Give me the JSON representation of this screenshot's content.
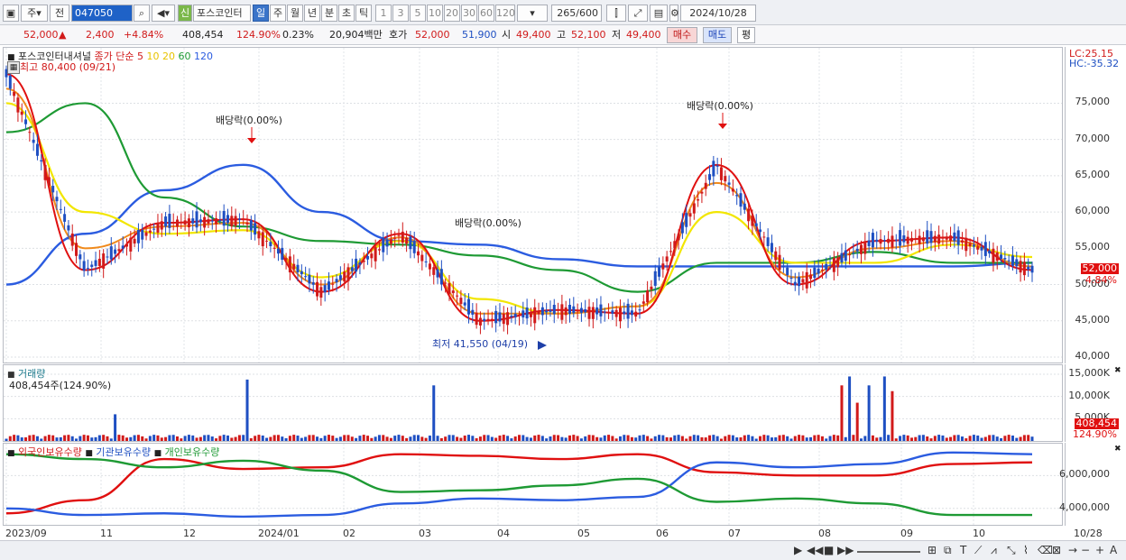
{
  "toolbar": {
    "market": "주",
    "prefix": "전",
    "code": "047050",
    "new_badge": "신",
    "stock_name": "포스코인터",
    "periods": [
      "일",
      "주",
      "월",
      "년",
      "분",
      "초",
      "틱"
    ],
    "active_period": "일",
    "intervals": [
      "1",
      "3",
      "5",
      "10",
      "20",
      "30",
      "60",
      "120"
    ],
    "count": "265",
    "count_total": "/600",
    "date": "2024/10/28"
  },
  "quote": {
    "price": "52,000",
    "change_arrow": "▲",
    "change": "2,400",
    "change_pct": "+4.84%",
    "volume": "408,454",
    "volume_ratio": "124.90%",
    "turnover": "0.23%",
    "amount": "20,904백만",
    "hoga_label": "호가",
    "ask": "52,000",
    "bid": "51,900",
    "open_label": "시",
    "open": "49,400",
    "high_label": "고",
    "high": "52,100",
    "low_label": "저",
    "low": "49,400",
    "buy_btn": "매수",
    "sell_btn": "매도",
    "eval_btn": "평"
  },
  "price_panel": {
    "title": "포스코인터내셔널",
    "ma_label": "종가 단순",
    "ma_periods": [
      "5",
      "10",
      "20",
      "60",
      "120"
    ],
    "high_note": "최고 80,400 (09/21)",
    "low_note": "최저 41,550 (04/19)",
    "dividend1": "배당락(0.00%)",
    "dividend2": "배당락(0.00%)",
    "dividend3": "배당락(0.00%)",
    "lc": "LC:25.15",
    "hc": "HC:-35.32",
    "y_ticks": [
      "75,000",
      "70,000",
      "65,000",
      "60,000",
      "55,000",
      "50,000",
      "45,000",
      "40,000"
    ],
    "last_price_tag": "52,000",
    "last_pct_tag": "4.84%"
  },
  "volume_panel": {
    "title": "거래량",
    "info": "408,454주(124.90%)",
    "y_ticks": [
      "15,000K",
      "10,000K",
      "5,000K"
    ],
    "tag": "408,454",
    "tag_pct": "124.90%"
  },
  "holding_panel": {
    "series": [
      "외국인보유수량",
      "기관보유수량",
      "개인보유수량"
    ],
    "y_ticks": [
      "6,000,000",
      "4,000,000"
    ]
  },
  "x_axis": [
    "2023/09",
    "11",
    "12",
    "2024/01",
    "02",
    "03",
    "04",
    "05",
    "06",
    "07",
    "08",
    "09",
    "10",
    "10/28"
  ],
  "colors": {
    "ma5": "#e01010",
    "ma10": "#f08a1c",
    "ma20": "#f2e600",
    "ma60": "#1e9a34",
    "ma120": "#2b5ce0",
    "up": "#d11a1a",
    "down": "#1e4fc2"
  },
  "chart_data": {
    "type": "line",
    "x": [
      "2023/09",
      "11",
      "12",
      "2024/01",
      "02",
      "03",
      "04",
      "05",
      "06",
      "07",
      "08",
      "09",
      "10",
      "10/28"
    ],
    "series": [
      {
        "name": "5",
        "values": [
          79000,
          52000,
          58500,
          59000,
          49000,
          57000,
          45000,
          46500,
          46000,
          66500,
          50000,
          56000,
          56500,
          52000
        ]
      },
      {
        "name": "10",
        "values": [
          77000,
          55000,
          58000,
          58500,
          50000,
          56500,
          46000,
          46000,
          47000,
          64000,
          51000,
          55000,
          56000,
          52500
        ]
      },
      {
        "name": "20",
        "values": [
          75000,
          60000,
          57000,
          57500,
          51000,
          56000,
          48000,
          46000,
          47000,
          60000,
          53000,
          53000,
          55500,
          53800
        ]
      },
      {
        "name": "60",
        "values": [
          71000,
          75000,
          62000,
          58000,
          56000,
          55500,
          54000,
          52000,
          49000,
          53000,
          53000,
          54500,
          53000,
          53000
        ]
      },
      {
        "name": "120",
        "values": [
          50000,
          57000,
          63000,
          66500,
          60000,
          56000,
          55500,
          53500,
          52500,
          52500,
          52500,
          52500,
          52500,
          53000
        ]
      }
    ],
    "ylim": [
      40000,
      80400
    ]
  }
}
